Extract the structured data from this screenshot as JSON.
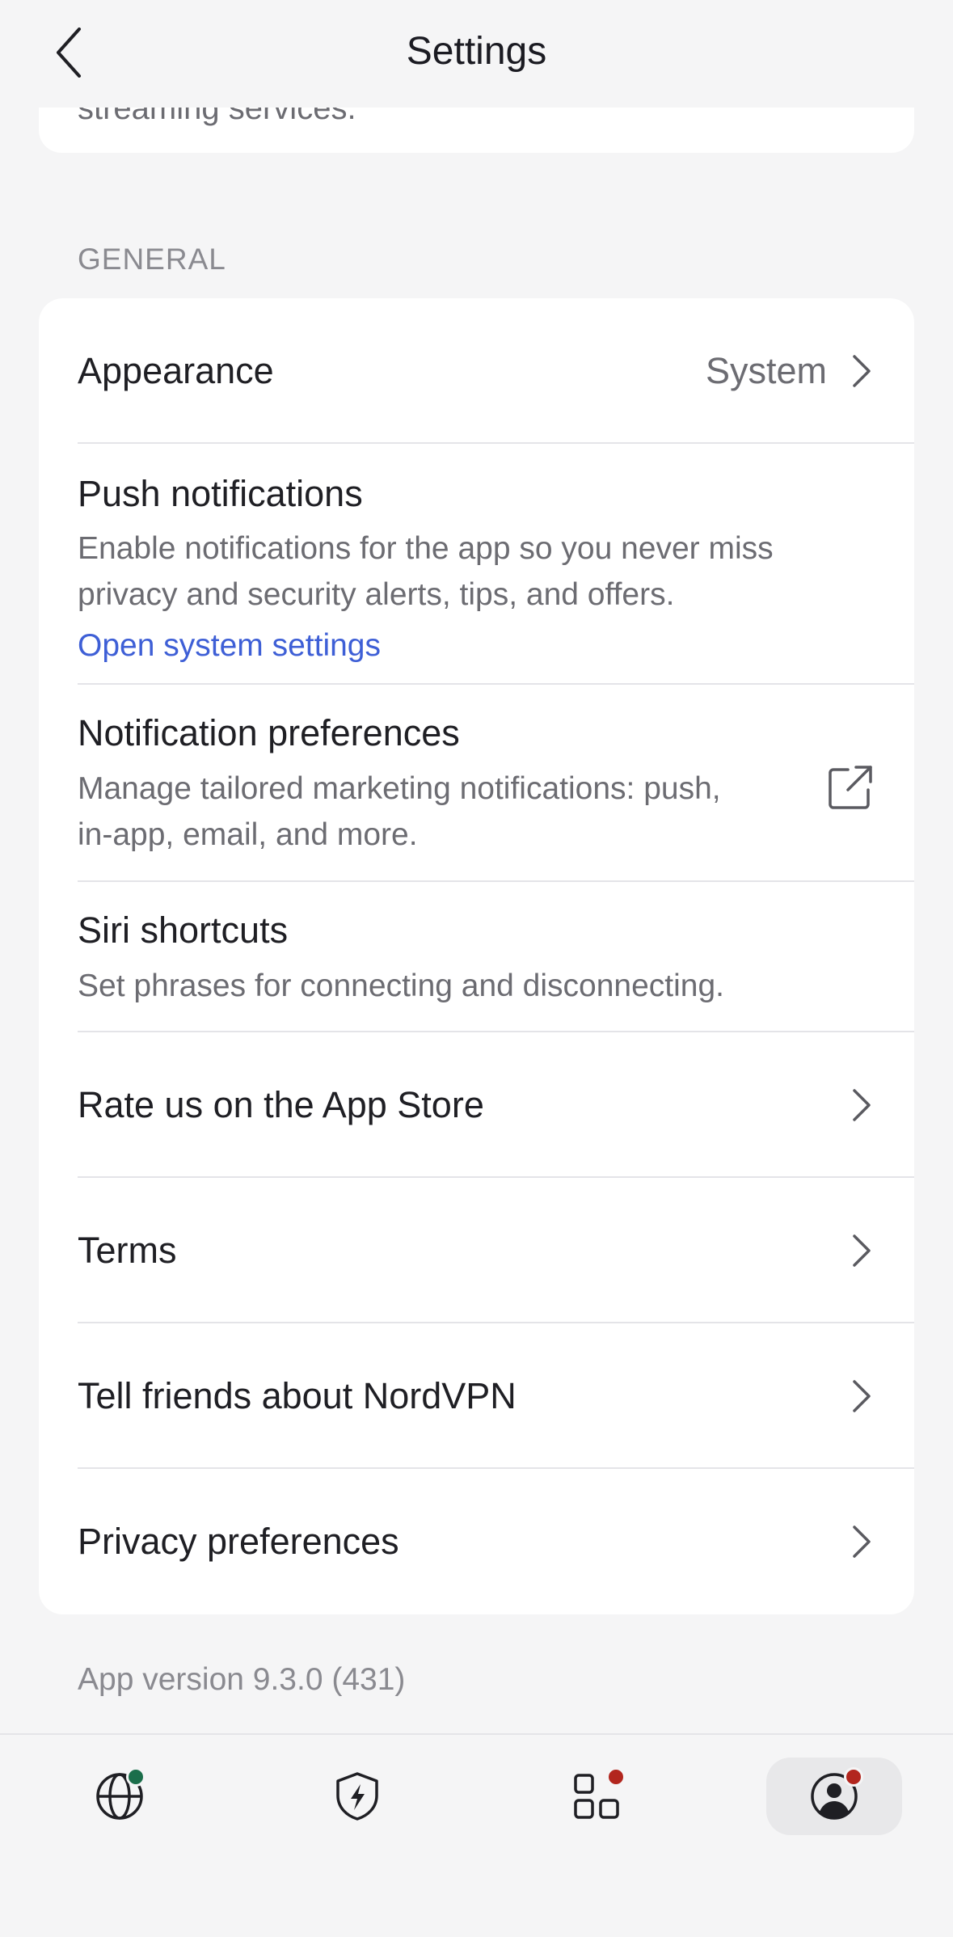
{
  "header": {
    "title": "Settings"
  },
  "top_card": {
    "text": "streaming services."
  },
  "general": {
    "label": "GENERAL",
    "appearance": {
      "title": "Appearance",
      "value": "System"
    },
    "push": {
      "title": "Push notifications",
      "desc_line1": "Enable notifications for the app so you never miss",
      "desc_line2": "privacy and security alerts, tips, and offers.",
      "link": "Open system settings"
    },
    "notif_prefs": {
      "title": "Notification preferences",
      "desc_line1": "Manage tailored marketing notifications: push,",
      "desc_line2": "in-app, email, and more."
    },
    "siri": {
      "title": "Siri shortcuts",
      "desc": "Set phrases for connecting and disconnecting."
    },
    "rate": {
      "title": "Rate us on the App Store"
    },
    "terms": {
      "title": "Terms"
    },
    "tell": {
      "title": "Tell friends about NordVPN"
    },
    "privacy": {
      "title": "Privacy preferences"
    }
  },
  "footer": {
    "version": "App version 9.3.0 (431)"
  },
  "tabbar": {
    "items": [
      {
        "icon": "globe-icon",
        "badge_color": "#1b6e4b"
      },
      {
        "icon": "shield-bolt-icon"
      },
      {
        "icon": "apps-grid-icon",
        "badge_color": "#b2261e"
      },
      {
        "icon": "profile-icon",
        "badge_color": "#b2261e",
        "active": true
      }
    ]
  },
  "colors": {
    "accent_link": "#3e5fd6",
    "background": "#f5f5f6",
    "card": "#ffffff"
  }
}
